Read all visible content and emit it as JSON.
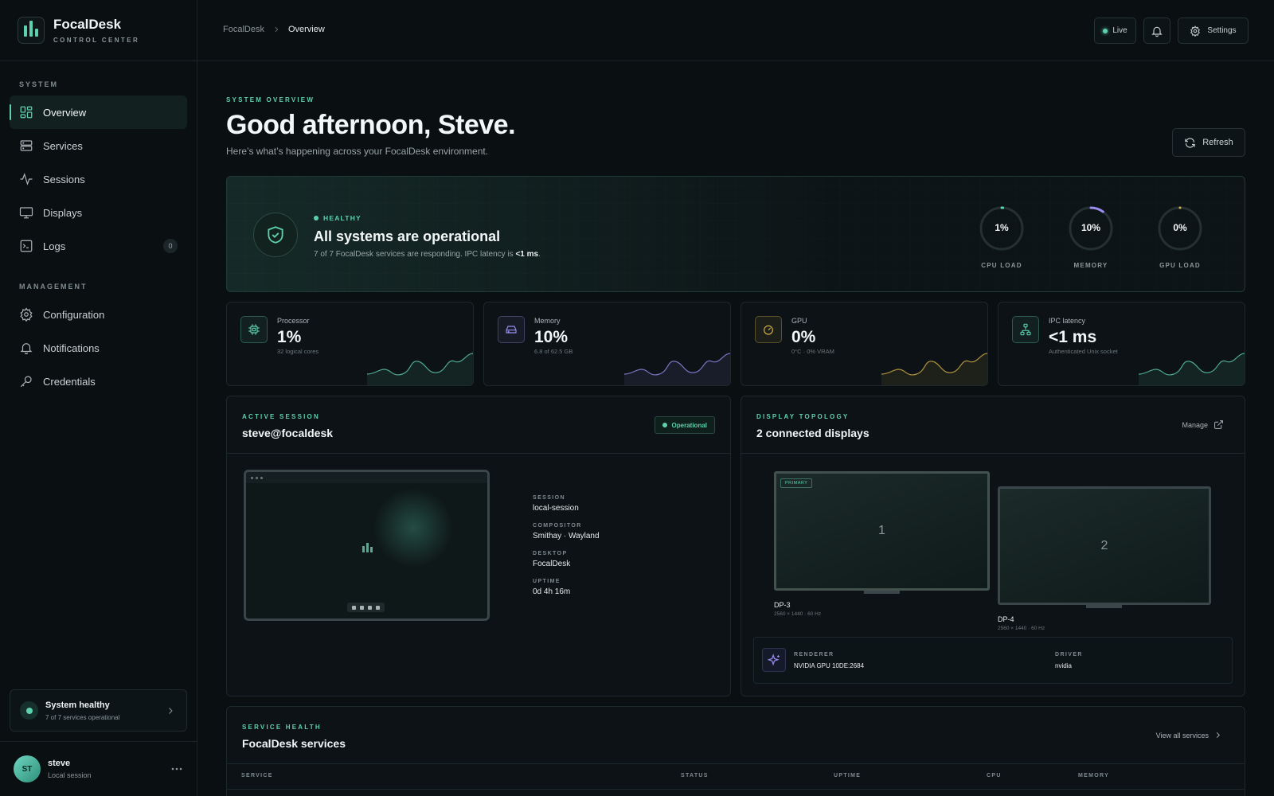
{
  "brand": {
    "name": "FocalDesk",
    "subtitle": "CONTROL CENTER"
  },
  "sidebar": {
    "system_label": "SYSTEM",
    "management_label": "MANAGEMENT",
    "system_items": [
      {
        "label": "Overview",
        "icon": "overview-icon",
        "active": true
      },
      {
        "label": "Services",
        "icon": "server-icon"
      },
      {
        "label": "Sessions",
        "icon": "activity-icon"
      },
      {
        "label": "Displays",
        "icon": "monitor-icon"
      },
      {
        "label": "Logs",
        "icon": "terminal-icon",
        "badge": "0"
      }
    ],
    "management_items": [
      {
        "label": "Configuration",
        "icon": "gear-icon"
      },
      {
        "label": "Notifications",
        "icon": "bell-icon"
      },
      {
        "label": "Credentials",
        "icon": "key-icon"
      }
    ],
    "health": {
      "title": "System healthy",
      "subtitle": "7 of 7 services operational"
    },
    "user": {
      "initials": "ST",
      "name": "steve",
      "subtitle": "Local session"
    }
  },
  "topbar": {
    "breadcrumb": [
      "FocalDesk",
      "Overview"
    ],
    "live_label": "Live",
    "settings_label": "Settings"
  },
  "header": {
    "eyebrow": "SYSTEM OVERVIEW",
    "title": "Good afternoon, Steve.",
    "subtitle": "Here’s what’s happening across your FocalDesk environment.",
    "refresh_label": "Refresh"
  },
  "status": {
    "badge": "HEALTHY",
    "title": "All systems are operational",
    "desc_prefix": "7 of 7 FocalDesk services are responding. IPC latency is ",
    "desc_value": "<1 ms",
    "desc_suffix": ".",
    "gauges": [
      {
        "value": "1%",
        "label": "CPU LOAD",
        "fraction": 0.01,
        "color": "#5fd0ad"
      },
      {
        "value": "10%",
        "label": "MEMORY",
        "fraction": 0.1,
        "color": "#9b8cf0"
      },
      {
        "value": "0%",
        "label": "GPU LOAD",
        "fraction": 0.0,
        "color": "#d8b34a"
      }
    ]
  },
  "stats": [
    {
      "label": "Processor",
      "value": "1%",
      "sub": "32 logical cores",
      "icon": "cpu-icon",
      "color": "#5fd0ad"
    },
    {
      "label": "Memory",
      "value": "10%",
      "sub": "6.8 of 62.5 GB",
      "icon": "drive-icon",
      "color": "#9b8cf0"
    },
    {
      "label": "GPU",
      "value": "0%",
      "sub": "0°C · 0% VRAM",
      "icon": "gauge-icon",
      "color": "#d8b34a"
    },
    {
      "label": "IPC latency",
      "value": "<1 ms",
      "sub": "Authenticated Unix socket",
      "icon": "network-icon",
      "color": "#5fd0ad"
    }
  ],
  "session": {
    "eyebrow": "ACTIVE SESSION",
    "title": "steve@focaldesk",
    "status": "Operational",
    "details": [
      {
        "key": "SESSION",
        "value": "local-session"
      },
      {
        "key": "COMPOSITOR",
        "value": "Smithay · Wayland"
      },
      {
        "key": "DESKTOP",
        "value": "FocalDesk"
      },
      {
        "key": "UPTIME",
        "value": "0d 4h 16m"
      }
    ]
  },
  "displays": {
    "eyebrow": "DISPLAY TOPOLOGY",
    "title": "2 connected displays",
    "manage_label": "Manage",
    "monitors": [
      {
        "number": "1",
        "name": "DP-3",
        "res": "2560 × 1440 · 60 Hz",
        "primary_label": "PRIMARY"
      },
      {
        "number": "2",
        "name": "DP-4",
        "res": "2560 × 1440 · 60 Hz"
      }
    ],
    "renderer_key": "RENDERER",
    "renderer_value": "NVIDIA GPU 10DE:2684",
    "driver_key": "DRIVER",
    "driver_value": "nvidia"
  },
  "services": {
    "eyebrow": "SERVICE HEALTH",
    "title": "FocalDesk services",
    "view_all_label": "View all services",
    "columns": [
      "SERVICE",
      "STATUS",
      "UPTIME",
      "CPU",
      "MEMORY"
    ]
  }
}
